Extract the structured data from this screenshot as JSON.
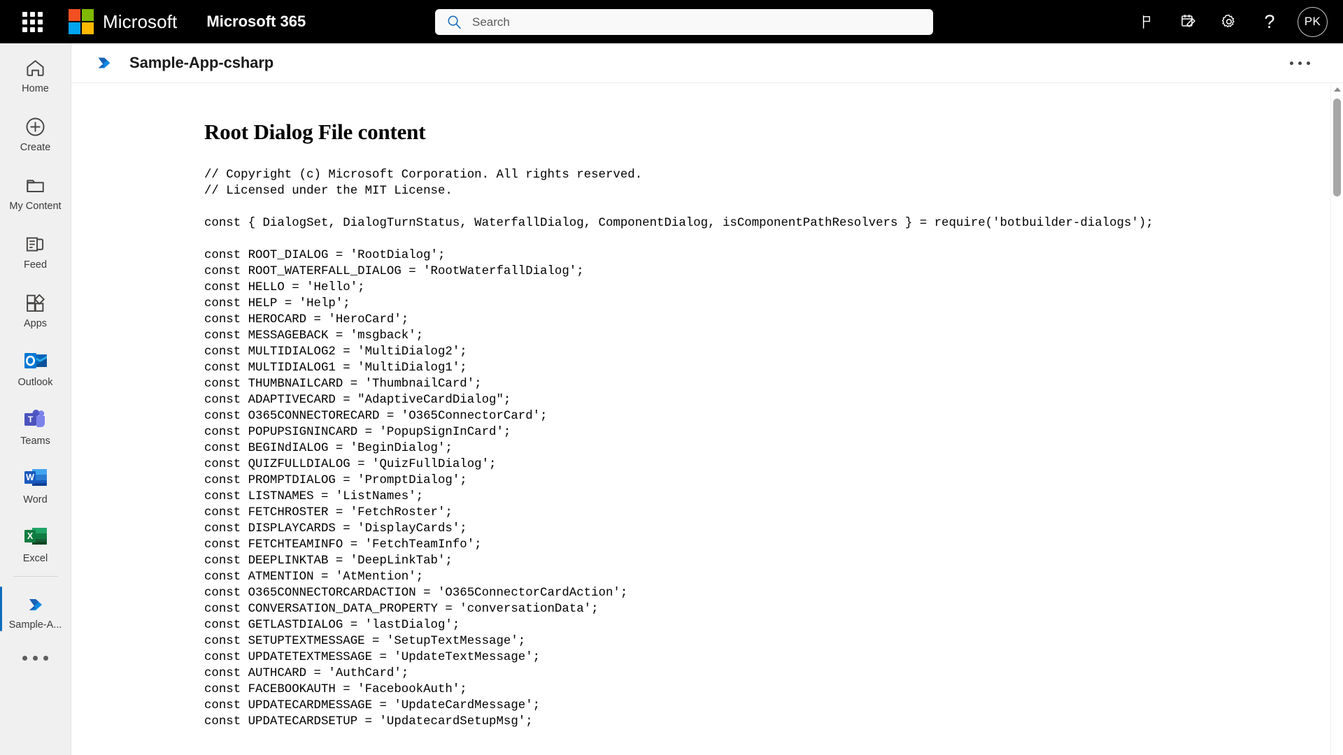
{
  "suitebar": {
    "waffle_label": "app-launcher",
    "brand": "Microsoft",
    "suite_name": "Microsoft 365",
    "search_placeholder": "Search",
    "search_value": "",
    "icons": [
      {
        "name": "flag-icon",
        "label": "Flag"
      },
      {
        "name": "calendar-check-icon",
        "label": "Planner"
      },
      {
        "name": "gear-icon",
        "label": "Settings"
      },
      {
        "name": "question-icon",
        "label": "Help",
        "glyph": "?"
      }
    ],
    "avatar_initials": "PK",
    "colors": {
      "background": "#000000",
      "ms_red": "#F25022",
      "ms_green": "#7FBA00",
      "ms_blue": "#00A4EF",
      "ms_yellow": "#FFB900",
      "search_bg": "#F9F9F9"
    }
  },
  "rail": {
    "items": [
      {
        "label": "Home",
        "icon": "home-icon",
        "selected": false
      },
      {
        "label": "Create",
        "icon": "plus-circle-icon",
        "selected": false
      },
      {
        "label": "My Content",
        "icon": "folder-icon",
        "selected": false
      },
      {
        "label": "Feed",
        "icon": "feed-icon",
        "selected": false
      },
      {
        "label": "Apps",
        "icon": "apps-icon",
        "selected": false
      },
      {
        "label": "Outlook",
        "icon": "outlook-icon",
        "selected": false
      },
      {
        "label": "Teams",
        "icon": "teams-icon",
        "selected": false
      },
      {
        "label": "Word",
        "icon": "word-icon",
        "selected": false
      },
      {
        "label": "Excel",
        "icon": "excel-icon",
        "selected": false
      }
    ],
    "pinned": {
      "label": "Sample-A...",
      "icon": "sample-app-icon",
      "selected": true
    },
    "more_label": "More apps",
    "accent_color": "#0F6CBD"
  },
  "apphead": {
    "title": "Sample-App-csharp",
    "logo_name": "sample-app-icon",
    "more_label": "More options"
  },
  "document": {
    "heading": "Root Dialog File content",
    "code": "// Copyright (c) Microsoft Corporation. All rights reserved.\n// Licensed under the MIT License.\n\nconst { DialogSet, DialogTurnStatus, WaterfallDialog, ComponentDialog, isComponentPathResolvers } = require('botbuilder-dialogs');\n\nconst ROOT_DIALOG = 'RootDialog';\nconst ROOT_WATERFALL_DIALOG = 'RootWaterfallDialog';\nconst HELLO = 'Hello';\nconst HELP = 'Help';\nconst HEROCARD = 'HeroCard';\nconst MESSAGEBACK = 'msgback';\nconst MULTIDIALOG2 = 'MultiDialog2';\nconst MULTIDIALOG1 = 'MultiDialog1';\nconst THUMBNAILCARD = 'ThumbnailCard';\nconst ADAPTIVECARD = \"AdaptiveCardDialog\";\nconst O365CONNECTORECARD = 'O365ConnectorCard';\nconst POPUPSIGNINCARD = 'PopupSignInCard';\nconst BEGINdIALOG = 'BeginDialog';\nconst QUIZFULLDIALOG = 'QuizFullDialog';\nconst PROMPTDIALOG = 'PromptDialog';\nconst LISTNAMES = 'ListNames';\nconst FETCHROSTER = 'FetchRoster';\nconst DISPLAYCARDS = 'DisplayCards';\nconst FETCHTEAMINFO = 'FetchTeamInfo';\nconst DEEPLINKTAB = 'DeepLinkTab';\nconst ATMENTION = 'AtMention';\nconst O365CONNECTORCARDACTION = 'O365ConnectorCardAction';\nconst CONVERSATION_DATA_PROPERTY = 'conversationData';\nconst GETLASTDIALOG = 'lastDialog';\nconst SETUPTEXTMESSAGE = 'SetupTextMessage';\nconst UPDATETEXTMESSAGE = 'UpdateTextMessage';\nconst AUTHCARD = 'AuthCard';\nconst FACEBOOKAUTH = 'FacebookAuth';\nconst UPDATECARDMESSAGE = 'UpdateCardMessage';\nconst UPDATECARDSETUP = 'UpdatecardSetupMsg';"
  },
  "scrollbar": {
    "up_arrow": "scroll-up-arrow",
    "thumb": "scroll-thumb"
  }
}
